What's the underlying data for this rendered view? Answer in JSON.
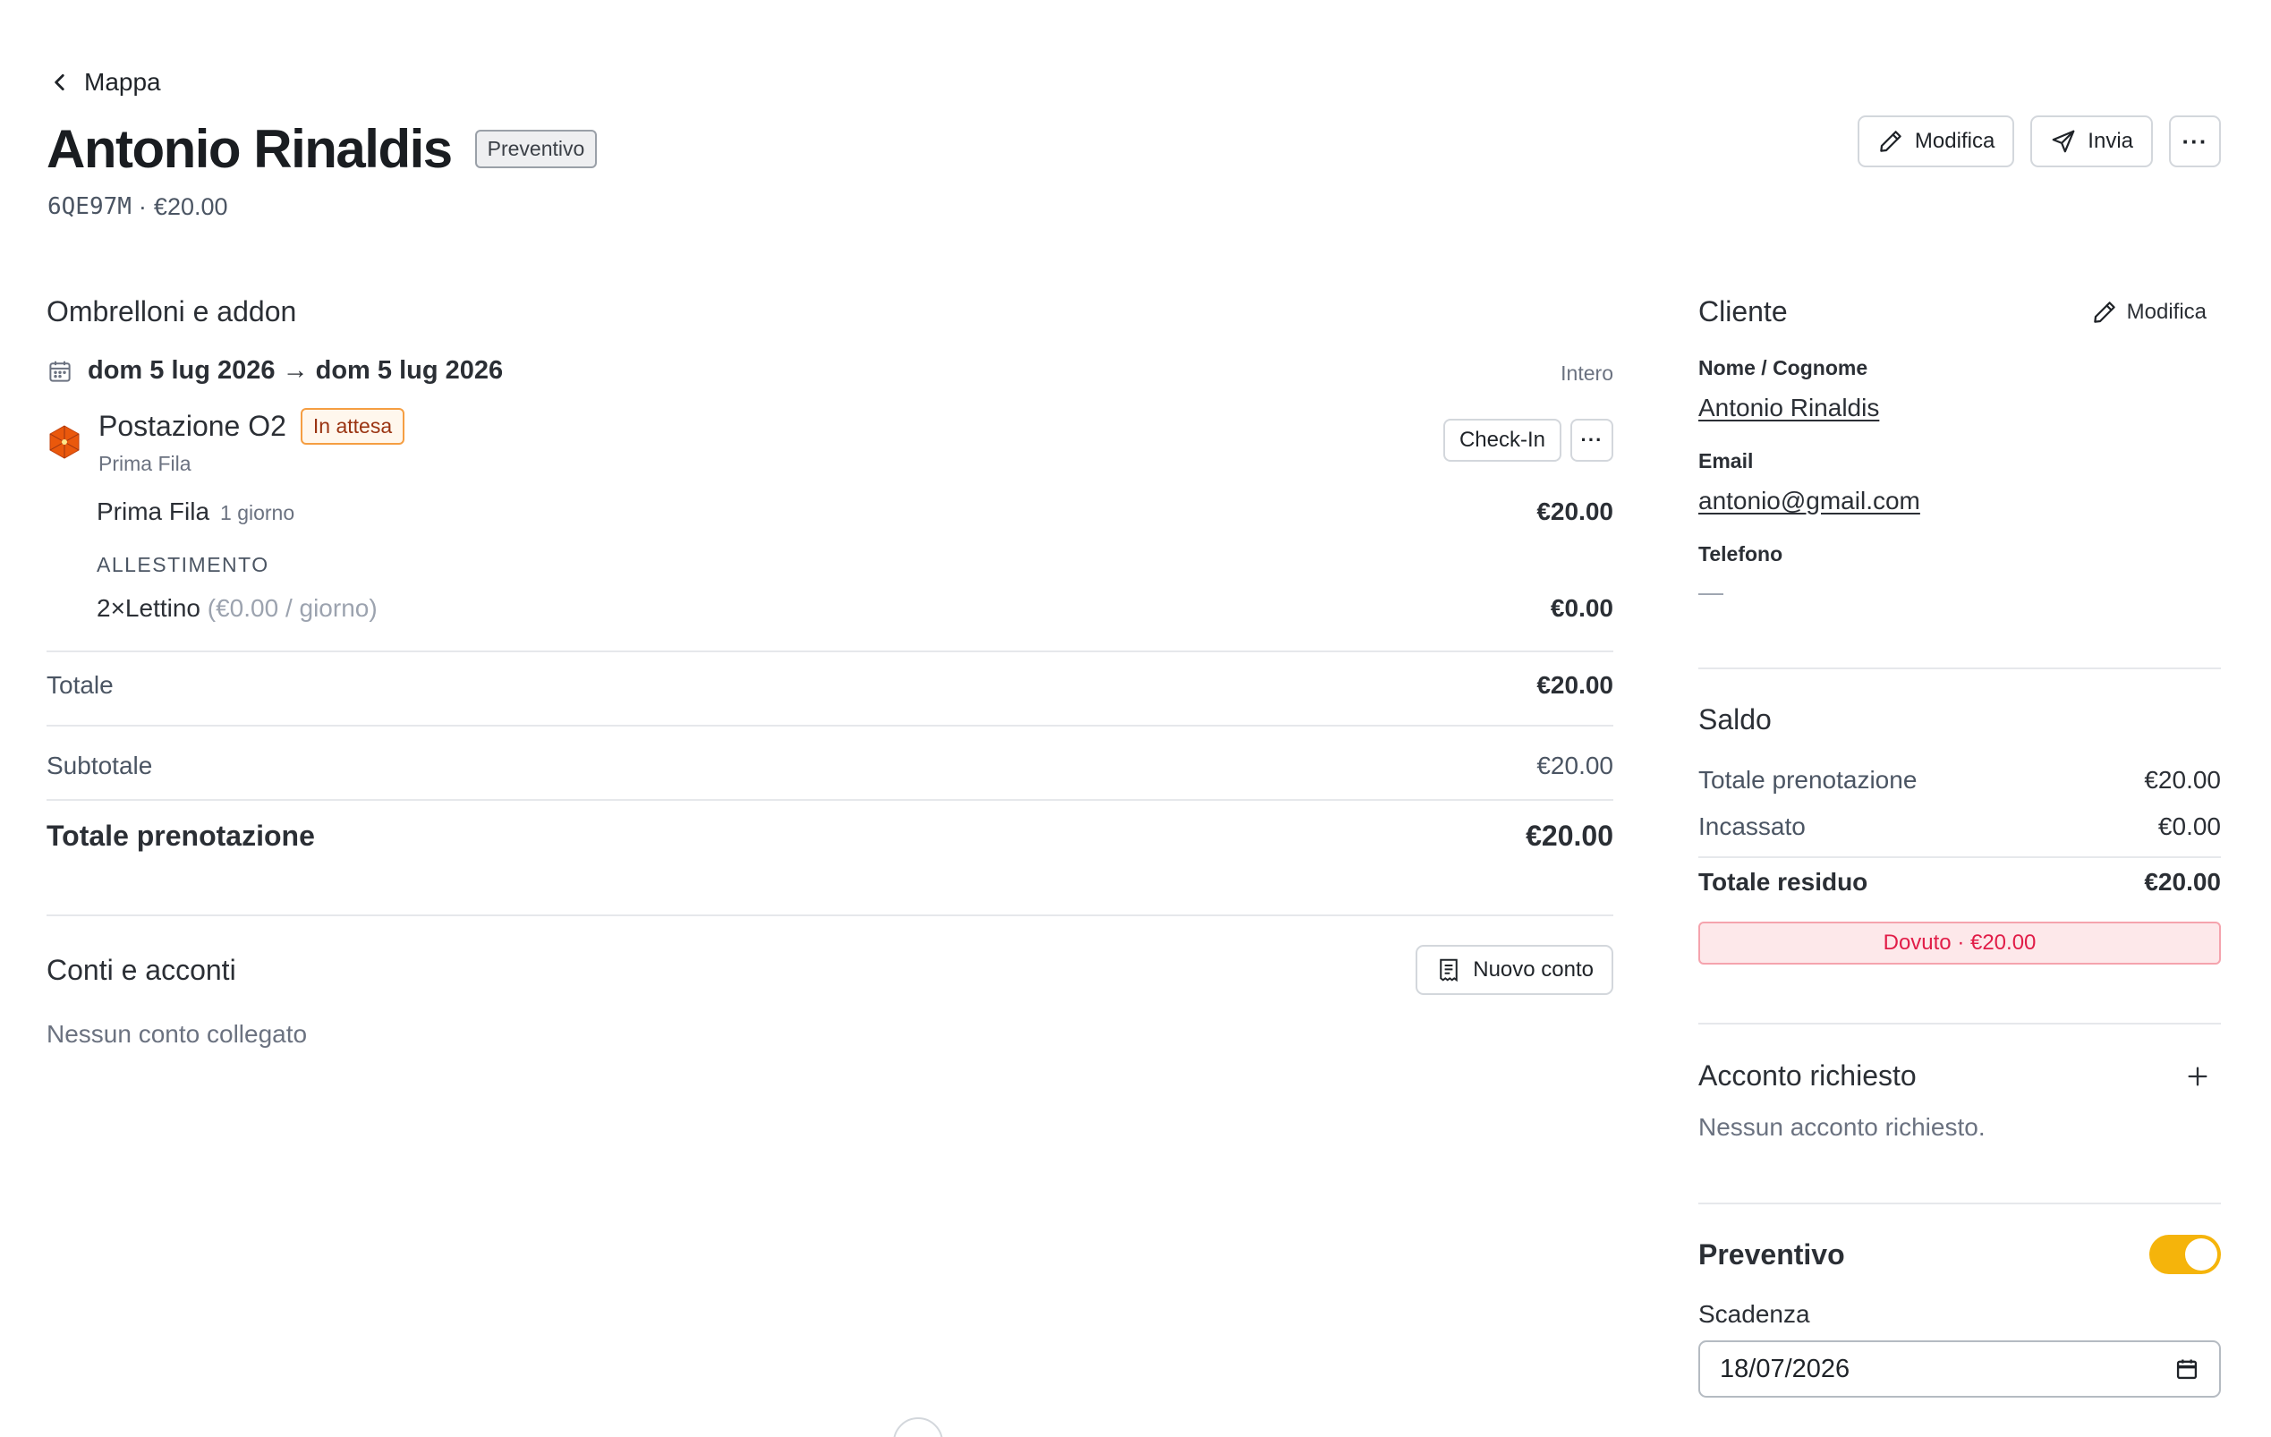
{
  "header": {
    "back_label": "Mappa",
    "title": "Antonio Rinaldis",
    "status_badge": "Preventivo",
    "code": "6QE97M",
    "separator": "·",
    "amount": "€20.00",
    "actions": {
      "edit": "Modifica",
      "send": "Invia",
      "more": "···"
    }
  },
  "booking": {
    "section_title": "Ombrelloni e addon",
    "date_range": "dom 5 lug 2026 → dom 5 lug 2026",
    "period": "Intero",
    "station": {
      "name": "Postazione O2",
      "status": "In attesa",
      "row": "Prima Fila",
      "checkin_label": "Check-In",
      "more": "···"
    },
    "items": [
      {
        "name": "Prima Fila",
        "detail": "1 giorno",
        "amount": "€20.00"
      }
    ],
    "setup_heading": "ALLESTIMENTO",
    "addons": [
      {
        "name": "2×Lettino",
        "detail": "(€0.00 / giorno)",
        "amount": "€0.00"
      }
    ],
    "total_label": "Totale",
    "total_value": "€20.00",
    "subtotal_label": "Subtotale",
    "subtotal_value": "€20.00",
    "grand_total_label": "Totale prenotazione",
    "grand_total_value": "€20.00"
  },
  "accounts": {
    "section_title": "Conti e acconti",
    "new_account_label": "Nuovo conto",
    "empty_text": "Nessun conto collegato"
  },
  "client": {
    "section_title": "Cliente",
    "edit_label": "Modifica",
    "name_label": "Nome / Cognome",
    "name_value": "Antonio Rinaldis",
    "email_label": "Email",
    "email_value": "antonio@gmail.com",
    "phone_label": "Telefono",
    "phone_value": "—"
  },
  "balance": {
    "section_title": "Saldo",
    "booking_total_label": "Totale prenotazione",
    "booking_total_value": "€20.00",
    "collected_label": "Incassato",
    "collected_value": "€0.00",
    "residual_label": "Totale residuo",
    "residual_value": "€20.00",
    "due_text": "Dovuto · €20.00"
  },
  "deposit": {
    "section_title": "Acconto richiesto",
    "add_icon": "plus-icon",
    "empty_text": "Nessun acconto richiesto."
  },
  "quote": {
    "section_title": "Preventivo",
    "toggle_on": true,
    "expiry_label": "Scadenza",
    "expiry_value": "18/07/2026"
  },
  "colors": {
    "accent_toggle": "#f5b40b",
    "warning_badge": "#f59e42",
    "due_red": "#e11d48",
    "umbrella_orange": "#ea580c"
  }
}
